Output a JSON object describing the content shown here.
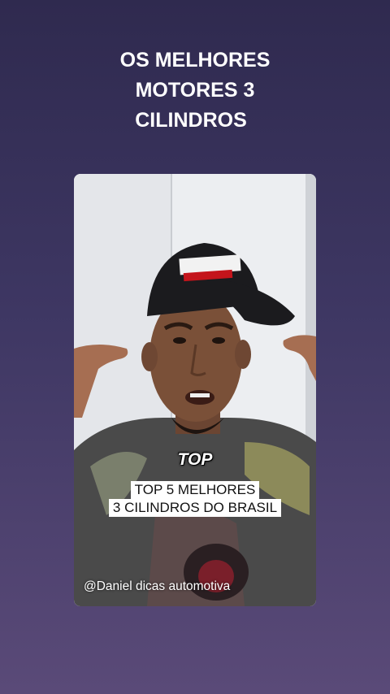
{
  "headline": {
    "line1": "OS MELHORES",
    "line2": "MOTORES 3",
    "line3": "CILINDROS"
  },
  "video": {
    "caption_top": "TOP",
    "caption_line1": "TOP 5 MELHORES",
    "caption_line2": "3 CILINDROS DO BRASIL",
    "watermark": "@Daniel dicas automotiva"
  }
}
